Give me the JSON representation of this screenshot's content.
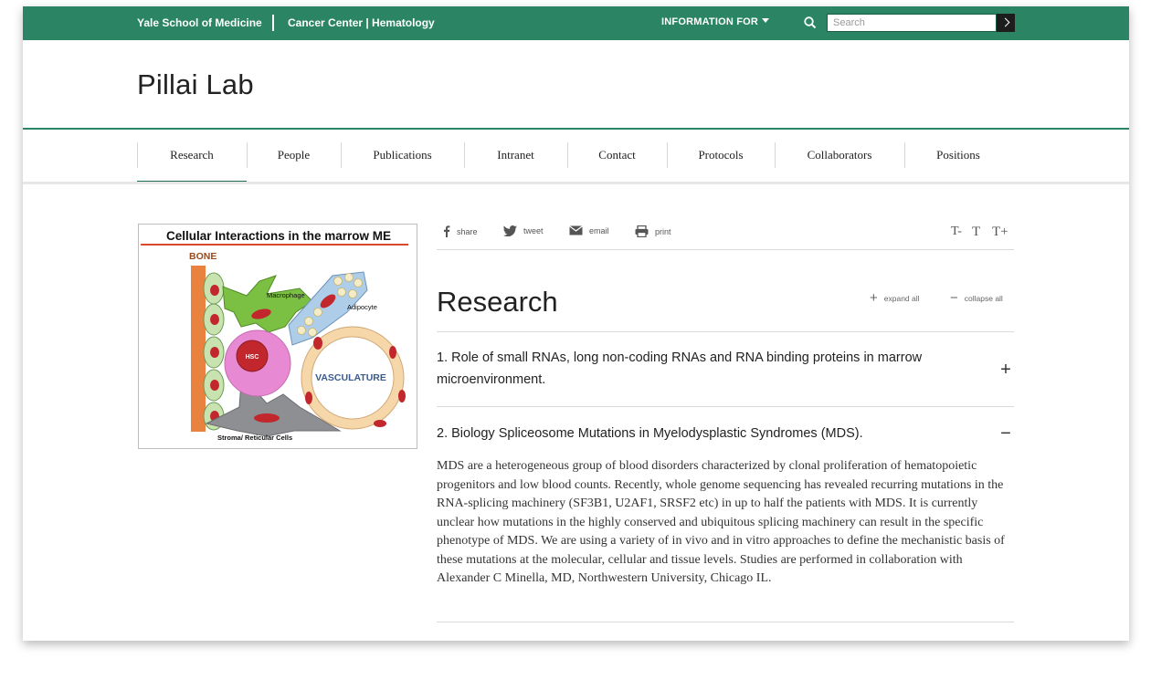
{
  "topbar": {
    "brand": "Yale School of Medicine",
    "dept": "Cancer Center | Hematology",
    "info_for": "INFORMATION FOR",
    "search_placeholder": "Search"
  },
  "site": {
    "title": "Pillai Lab"
  },
  "nav": {
    "items": [
      {
        "label": "Research",
        "active": true
      },
      {
        "label": "People"
      },
      {
        "label": "Publications"
      },
      {
        "label": "Intranet"
      },
      {
        "label": "Contact"
      },
      {
        "label": "Protocols"
      },
      {
        "label": "Collaborators"
      },
      {
        "label": "Positions"
      }
    ]
  },
  "figure": {
    "title": "Cellular Interactions in the marrow ME",
    "labels": {
      "bone": "BONE",
      "macrophage": "Macrophage",
      "adipocyte": "Adipocyte",
      "hsc": "HSC",
      "vasculature": "VASCULATURE",
      "stroma": "Stroma/ Reticular Cells"
    }
  },
  "share": {
    "share": "share",
    "tweet": "tweet",
    "email": "email",
    "print": "print",
    "text_size": [
      "T-",
      "T",
      "T+"
    ]
  },
  "main": {
    "heading": "Research",
    "expand_all": "expand all",
    "collapse_all": "collapse all",
    "sections": [
      {
        "title": "1. Role of small RNAs, long non-coding RNAs and RNA binding proteins in marrow microenvironment.",
        "toggle": "+",
        "expanded": false
      },
      {
        "title": "2. Biology Spliceosome Mutations in Myelodysplastic Syndromes (MDS).",
        "toggle": "−",
        "expanded": true,
        "body": "MDS are a heterogeneous group of blood disorders characterized by clonal proliferation of hematopoietic progenitors and low blood counts. Recently, whole genome sequencing has revealed recurring mutations in the RNA-splicing machinery (SF3B1, U2AF1, SRSF2 etc) in up to half the patients with MDS. It is currently unclear how mutations in the highly conserved and ubiquitous splicing machinery can result in the specific phenotype of MDS. We are using a variety of in vivo and in vitro approaches to define the mechanistic basis of these mutations at the molecular, cellular and tissue levels. Studies are performed in collaboration with Alexander C Minella, MD, Northwestern University, Chicago IL."
      }
    ]
  },
  "colors": {
    "brand_green": "#2b8565",
    "nav_active": "#1f6e52"
  }
}
